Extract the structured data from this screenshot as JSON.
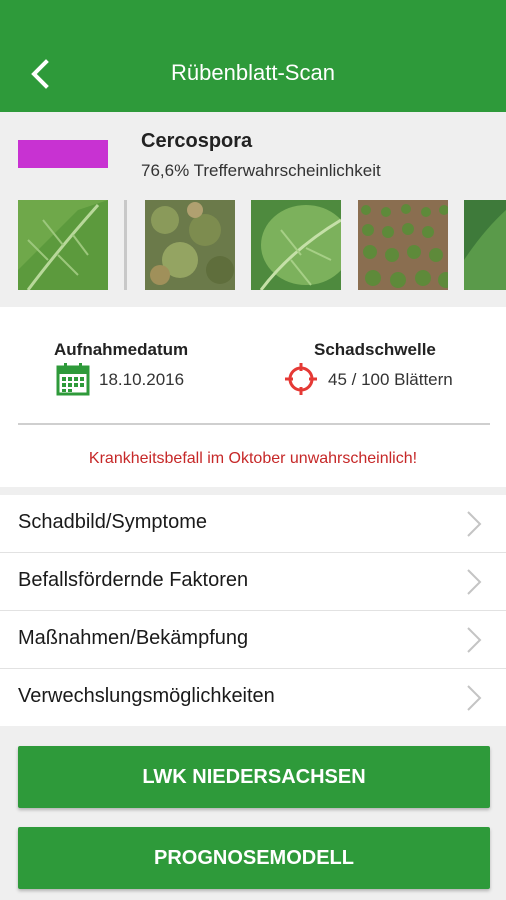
{
  "colors": {
    "accent": "#2e9a3a",
    "disease_marker": "#c832d2",
    "warning": "#c62828",
    "target_icon": "#e53935"
  },
  "appbar": {
    "title": "Rübenblatt-Scan",
    "back_icon": "chevron-left-icon"
  },
  "disease": {
    "name": "Cercospora",
    "probability": "76,6% Trefferwahrscheinlichkeit"
  },
  "info": {
    "date_label": "Aufnahmedatum",
    "date_value": "18.10.2016",
    "date_icon": "calendar-icon",
    "threshold_label": "Schadschwelle",
    "threshold_value": "45 / 100 Blättern",
    "threshold_icon": "target-icon",
    "warning": "Krankheitsbefall im Oktober unwahrscheinlich!"
  },
  "menu": {
    "items": [
      {
        "label": "Schadbild/Symptome"
      },
      {
        "label": "Befallsfördernde Faktoren"
      },
      {
        "label": "Maßnahmen/Bekämpfung"
      },
      {
        "label": "Verwechslungsmöglichkeiten"
      }
    ]
  },
  "buttons": {
    "lwk": "LWK NIEDERSACHSEN",
    "prognose": "PROGNOSEMODELL"
  }
}
